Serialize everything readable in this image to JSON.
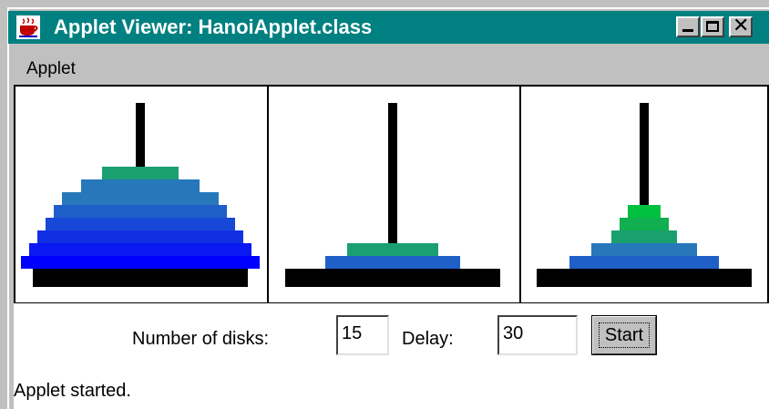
{
  "window": {
    "title": "Applet Viewer: HanoiApplet.class",
    "icon": "java-coffee-cup-icon",
    "titlebar_color": "#008080",
    "buttons": [
      "minimize",
      "maximize",
      "close"
    ],
    "close_glyph": "✕"
  },
  "menu": {
    "items": [
      "Applet"
    ]
  },
  "hanoi": {
    "pegs": [
      {
        "disk_count": 8
      },
      {
        "disk_count": 2
      },
      {
        "disk_count": 5
      }
    ],
    "disk_colors": [
      "#0000ff",
      "#0a18f2",
      "#1130e4",
      "#1848d6",
      "#1f60c8",
      "#2678ba",
      "#2d90ac",
      "#1aa070",
      "#00c040"
    ]
  },
  "controls": {
    "disks_label": "Number of disks:",
    "disks_value": "15",
    "delay_label": "Delay:",
    "delay_value": "30",
    "start_label": "Start"
  },
  "status": "Applet started."
}
